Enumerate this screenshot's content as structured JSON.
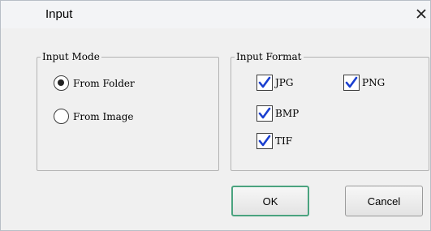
{
  "dialog": {
    "title": "Input",
    "close_icon": "close-icon"
  },
  "input_mode": {
    "label": "Input Mode",
    "options": [
      {
        "label": "From Folder",
        "selected": true
      },
      {
        "label": "From Image",
        "selected": false
      }
    ]
  },
  "input_format": {
    "label": "Input Format",
    "options": [
      {
        "label": "JPG",
        "checked": true
      },
      {
        "label": "PNG",
        "checked": true
      },
      {
        "label": "BMP",
        "checked": true
      },
      {
        "label": "TIF",
        "checked": true
      }
    ]
  },
  "buttons": {
    "ok": "OK",
    "cancel": "Cancel"
  },
  "colors": {
    "check": "#1a3fd0",
    "ok_border": "#4aa37f"
  }
}
